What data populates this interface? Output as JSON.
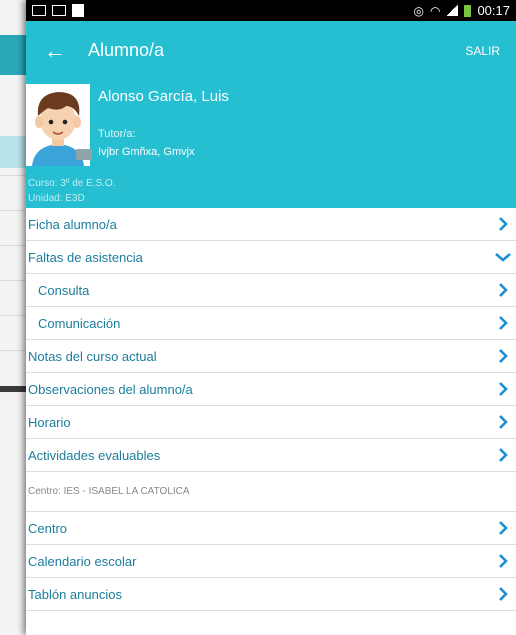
{
  "statusbar": {
    "time": "00:17"
  },
  "toolbar": {
    "back": "←",
    "title": "Alumno/a",
    "logout": "SALIR"
  },
  "student": {
    "name": "Alonso García, Luis",
    "tutor_label": "Tutor/a:",
    "tutor_name": "Ivjbr Gmñxa, Gmvjx",
    "curso": "Curso:  3º de E.S.O.",
    "unidad": "Unidad: E3D"
  },
  "menu": {
    "ficha": "Ficha alumno/a",
    "faltas": "Faltas de asistencia",
    "consulta": "Consulta",
    "comunicacion": "Comunicación",
    "notas": "Notas del curso actual",
    "observaciones": "Observaciones del alumno/a",
    "horario": "Horario",
    "actividades": "Actividades evaluables"
  },
  "centro_section": {
    "label": "Centro: IES - ISABEL LA CATOLICA",
    "centro": "Centro",
    "calendario": "Calendario escolar",
    "tablon": "Tablón anuncios"
  },
  "colors": {
    "accent": "#26bfd2",
    "link": "#1c7d9c",
    "chevron": "#1a8fd6"
  }
}
